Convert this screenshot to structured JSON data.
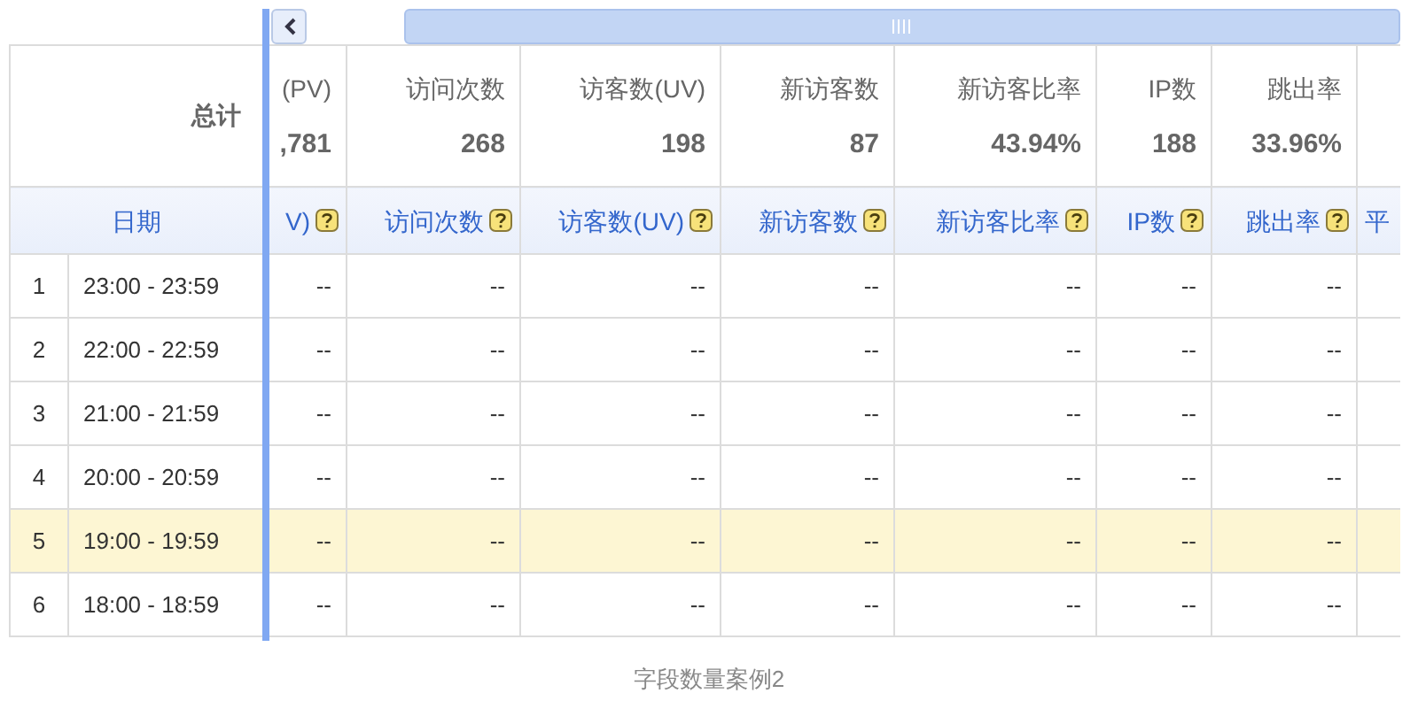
{
  "summary": {
    "label": "总计",
    "columns": [
      {
        "name": "(PV)",
        "value": ",781"
      },
      {
        "name": "访问次数",
        "value": "268"
      },
      {
        "name": "访客数(UV)",
        "value": "198"
      },
      {
        "name": "新访客数",
        "value": "87"
      },
      {
        "name": "新访客比率",
        "value": "43.94%"
      },
      {
        "name": "IP数",
        "value": "188"
      },
      {
        "name": "跳出率",
        "value": "33.96%"
      }
    ]
  },
  "header": {
    "date": "日期",
    "columns": [
      {
        "label": "V)",
        "help": true
      },
      {
        "label": "访问次数",
        "help": true
      },
      {
        "label": "访客数(UV)",
        "help": true
      },
      {
        "label": "新访客数",
        "help": true
      },
      {
        "label": "新访客比率",
        "help": true
      },
      {
        "label": "IP数",
        "help": true
      },
      {
        "label": "跳出率",
        "help": true
      },
      {
        "label": "平",
        "help": false
      }
    ]
  },
  "rows": [
    {
      "index": "1",
      "date": "23:00 - 23:59",
      "selected": false,
      "cells": [
        "--",
        "--",
        "--",
        "--",
        "--",
        "--",
        "--"
      ]
    },
    {
      "index": "2",
      "date": "22:00 - 22:59",
      "selected": false,
      "cells": [
        "--",
        "--",
        "--",
        "--",
        "--",
        "--",
        "--"
      ]
    },
    {
      "index": "3",
      "date": "21:00 - 21:59",
      "selected": false,
      "cells": [
        "--",
        "--",
        "--",
        "--",
        "--",
        "--",
        "--"
      ]
    },
    {
      "index": "4",
      "date": "20:00 - 20:59",
      "selected": false,
      "cells": [
        "--",
        "--",
        "--",
        "--",
        "--",
        "--",
        "--"
      ]
    },
    {
      "index": "5",
      "date": "19:00 - 19:59",
      "selected": true,
      "cells": [
        "--",
        "--",
        "--",
        "--",
        "--",
        "--",
        "--"
      ]
    },
    {
      "index": "6",
      "date": "18:00 - 18:59",
      "selected": false,
      "cells": [
        "--",
        "--",
        "--",
        "--",
        "--",
        "--",
        "--"
      ]
    }
  ],
  "caption": "字段数量案例2"
}
